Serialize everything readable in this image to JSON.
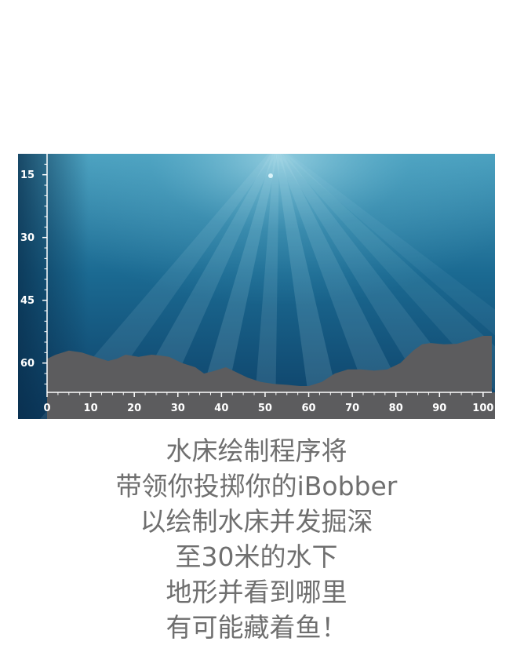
{
  "chart_data": {
    "type": "area",
    "title": "",
    "xlabel": "",
    "ylabel": "",
    "y_axis_inverted": true,
    "x_ticks": [
      0,
      10,
      20,
      30,
      40,
      50,
      60,
      70,
      80,
      90,
      100
    ],
    "y_ticks": [
      15,
      30,
      45,
      60
    ],
    "xlim": [
      0,
      102
    ],
    "ylim": [
      10,
      67
    ],
    "grid": false,
    "series": [
      {
        "x": [
          0,
          2,
          5,
          8,
          11,
          14,
          16,
          18,
          21,
          24,
          26,
          28,
          31,
          34,
          36,
          38,
          41,
          43,
          46,
          49,
          52,
          55,
          58,
          60,
          63,
          66,
          69,
          72,
          75,
          78,
          81,
          84,
          86,
          88,
          91,
          94,
          97,
          100,
          102
        ],
        "y": [
          59,
          58,
          57,
          57.5,
          58.5,
          59.5,
          59,
          58,
          58.5,
          58,
          58.2,
          58.5,
          60,
          61,
          62.5,
          62,
          61,
          62,
          63.5,
          64.5,
          65,
          65.2,
          65.5,
          65.5,
          64.5,
          62.5,
          61.5,
          61.5,
          61.8,
          61.5,
          60,
          57,
          55.5,
          55.2,
          55.5,
          55.4,
          54.5,
          53.5,
          53.5
        ]
      }
    ],
    "colors": {
      "water_deep": "#0d3f66",
      "water_mid": "#1b6a92",
      "water_light": "#4aa0bf",
      "seabed": "#5c5c5e",
      "axis": "#ffffff"
    }
  },
  "caption": {
    "lines": [
      "水床绘制程序将",
      "带领你投掷你的iBobber",
      "以绘制水床并发掘深",
      "至30米的水下",
      "地形并看到哪里",
      "有可能藏着鱼！"
    ]
  }
}
